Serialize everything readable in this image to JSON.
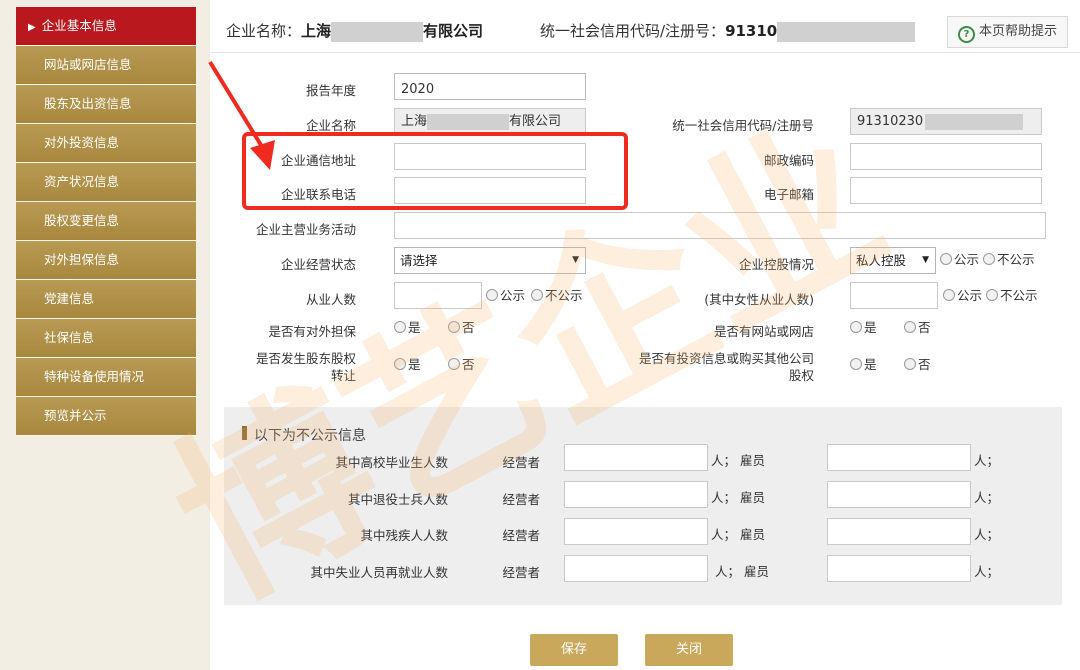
{
  "sidebar": {
    "items": [
      {
        "label": "企业基本信息",
        "active": true
      },
      {
        "label": "网站或网店信息"
      },
      {
        "label": "股东及出资信息"
      },
      {
        "label": "对外投资信息"
      },
      {
        "label": "资产状况信息"
      },
      {
        "label": "股权变更信息"
      },
      {
        "label": "对外担保信息"
      },
      {
        "label": "党建信息"
      },
      {
        "label": "社保信息"
      },
      {
        "label": "特种设备使用情况"
      },
      {
        "label": "预览并公示"
      }
    ],
    "active_marker": "▶"
  },
  "header": {
    "company_label": "企业名称：",
    "company_prefix": "上海",
    "company_suffix": "有限公司",
    "credit_label": "统一社会信用代码/注册号：",
    "credit_prefix": "91310",
    "help_label": "本页帮助提示"
  },
  "form": {
    "report_year": {
      "label": "报告年度",
      "value": "2020"
    },
    "company_name": {
      "label": "企业名称",
      "value_prefix": "上海",
      "value_suffix": "有限公司"
    },
    "credit_code": {
      "label": "统一社会信用代码/注册号",
      "value_prefix": "91310230"
    },
    "address": {
      "label": "企业通信地址",
      "value": ""
    },
    "postcode": {
      "label": "邮政编码",
      "value": ""
    },
    "phone": {
      "label": "企业联系电话",
      "value": ""
    },
    "email": {
      "label": "电子邮箱",
      "value": ""
    },
    "main_business": {
      "label": "企业主营业务活动",
      "value": ""
    },
    "status": {
      "label": "企业经营状态",
      "selected": "请选择"
    },
    "holding": {
      "label": "企业控股情况",
      "selected": "私人控股"
    },
    "employees": {
      "label": "从业人数",
      "value": ""
    },
    "female_employees": {
      "label": "(其中女性从业人数)",
      "value": ""
    },
    "guarantee": {
      "label": "是否有对外担保"
    },
    "website": {
      "label": "是否有网站或网店"
    },
    "equity_transfer": {
      "label_line1": "是否发生股东股权",
      "label_line2": "转让"
    },
    "investment": {
      "label_line1": "是否有投资信息或购买其他公司",
      "label_line2": "股权"
    },
    "opt_public": "公示",
    "opt_private": "不公示",
    "opt_yes": "是",
    "opt_no": "否"
  },
  "nonpublic": {
    "title": "以下为不公示信息",
    "operator_label": "经营者",
    "person_unit": "人；",
    "employee_label": "雇员",
    "rows": [
      {
        "label": "其中高校毕业生人数"
      },
      {
        "label": "其中退役士兵人数"
      },
      {
        "label": "其中残疾人人数"
      },
      {
        "label": "其中失业人员再就业人数"
      }
    ]
  },
  "buttons": {
    "save": "保存",
    "close": "关闭"
  },
  "watermark": {
    "text": "博艺企业"
  },
  "colors": {
    "sidebar_active": "#b8181e",
    "sidebar_item": "#b0903f",
    "button": "#c9a85c",
    "annotation": "#ef2a1e"
  }
}
